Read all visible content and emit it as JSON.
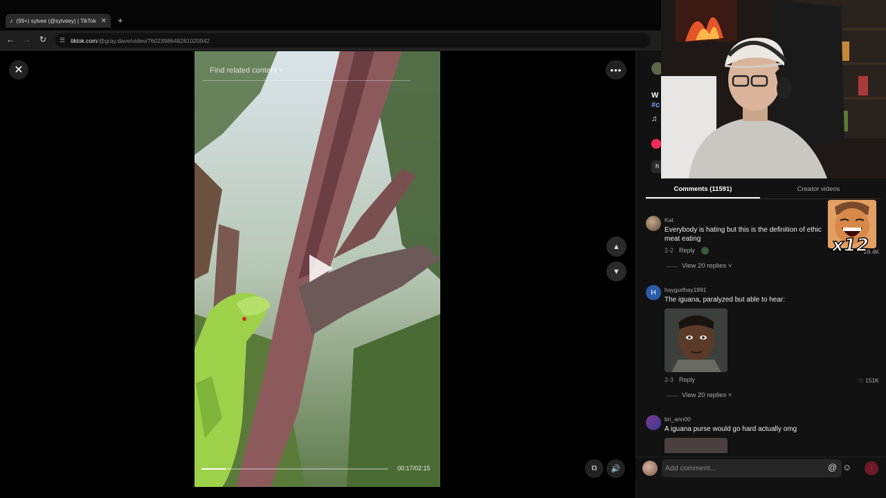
{
  "browser": {
    "tab_title": "(99+) sylvee (@sylveey) | TikTok",
    "tab_close": "✕",
    "new_tab": "+",
    "url_host": "tiktok.com",
    "url_path": "/@gray.dave/video/7602398648261020942"
  },
  "viewer": {
    "find_related": "Find related content",
    "timecode": "00:17/02:15",
    "progress": 0.13
  },
  "panel": {
    "partial_1": "W",
    "partial_2": "#c",
    "partial_3": "♫",
    "partial_4": "h",
    "tabs": {
      "comments": "Comments (11591)",
      "creator": "Creator videos"
    },
    "comments": [
      {
        "user": "Kat",
        "text_1": "Everybody is hating but this is the definition of ethic",
        "text_2": "meat eating",
        "date": "2-2",
        "reply": "Reply",
        "likes": "29.4K",
        "view_replies": "View 20 replies"
      },
      {
        "user": "haygurlhay1991",
        "text_1": "The iguana, paralyzed but able to hear:",
        "date": "2-3",
        "reply": "Reply",
        "likes": "151K",
        "view_replies": "View 20 replies",
        "avatar_letter": "H"
      },
      {
        "user": "bri_ann00",
        "text_1": "A iguana purse would go hard actually omg"
      }
    ],
    "add_comment_placeholder": "Add comment..."
  },
  "overlay": {
    "emote_count": "x12"
  },
  "colors": {
    "accent": "#fe2c55",
    "panel_bg": "#121212"
  }
}
